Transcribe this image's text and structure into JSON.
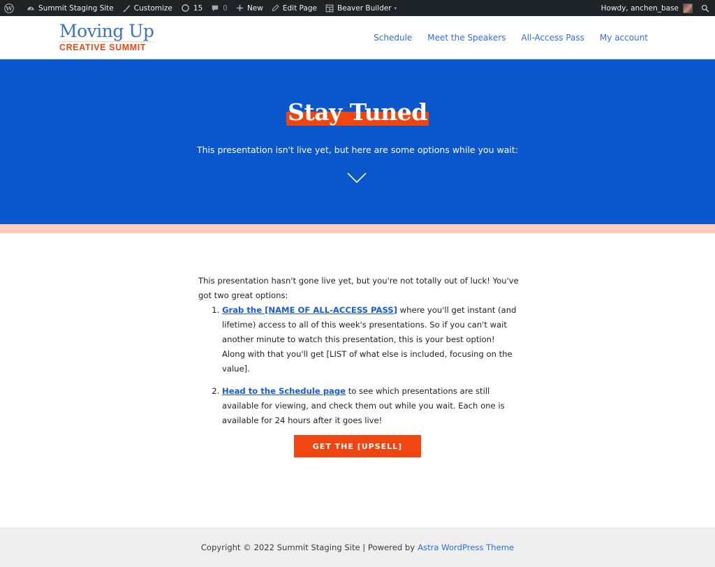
{
  "admin_bar": {
    "wp_logo_icon": "wordpress-icon",
    "site_name": "Summit Staging Site",
    "customize": "Customize",
    "updates_count": "15",
    "comments_count": "0",
    "new": "New",
    "edit_page": "Edit Page",
    "beaver_builder": "Beaver Builder",
    "howdy": "Howdy, anchen_base"
  },
  "header": {
    "logo_top": "Moving Up",
    "logo_bottom": "CREATIVE SUMMIT",
    "nav": [
      {
        "label": "Schedule"
      },
      {
        "label": "Meet the Speakers"
      },
      {
        "label": "All-Access Pass"
      },
      {
        "label": "My account"
      }
    ]
  },
  "hero": {
    "title": "Stay Tuned",
    "subtitle": "This presentation isn't live yet, but here are some options while you wait:",
    "chevron_icon": "chevron-down-icon"
  },
  "content": {
    "intro": "This presentation hasn't gone live yet, but you're not totally out of luck! You've got two great options:",
    "options": [
      {
        "link": "Grab the [NAME OF ALL-ACCESS PASS]",
        "text": " where you'll get instant (and lifetime) access to all of this week's presentations. So if you can't wait another minute to watch this presentation, this is your best option! Along with that you'll get [LIST of what else is included, focusing on the value]."
      },
      {
        "link": "Head to the Schedule page",
        "text": " to see which presentations are still available for viewing, and check them out while you wait. Each one is available for 24 hours after it goes live!"
      }
    ],
    "cta_label": "GET THE [UPSELL]"
  },
  "footer": {
    "copyright": "Copyright © 2022 Summit Staging Site | Powered by",
    "theme_link": "Astra WordPress Theme"
  },
  "colors": {
    "admin_bar_bg": "#1d2327",
    "brand_blue": "#0a56cc",
    "link_blue": "#2f6fd6",
    "accent_orange": "#ef4510",
    "pink_band": "#fecdbf",
    "footer_bg": "#efefef"
  }
}
